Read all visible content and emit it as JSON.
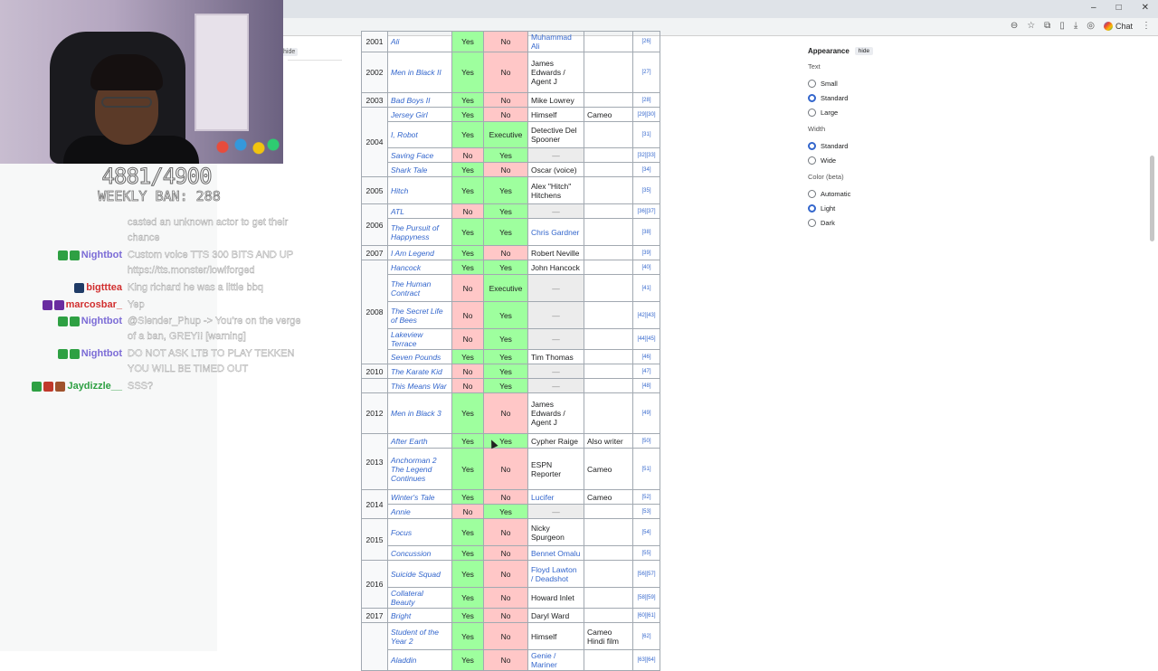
{
  "browser": {
    "win_controls": [
      "–",
      "□",
      "✕"
    ],
    "chat_label": "Chat"
  },
  "sidebar": {
    "hide_label": "hide"
  },
  "stream": {
    "counter": "4881/4900",
    "weekly": "WEEKLY BAN: 288"
  },
  "chat": [
    {
      "user": "",
      "msg": "casted an unknown actor to get their",
      "color": "#ffffff"
    },
    {
      "user": "",
      "msg": "chance",
      "color": "#ffffff"
    },
    {
      "user": "Nightbot",
      "msg": "Custom voice TTS 300 BITS AND UP",
      "color": "#7b6bd6"
    },
    {
      "user": "",
      "msg": "https://tts.monster/lowlforged",
      "color": "#ffffff"
    },
    {
      "user": "bigtttea",
      "msg": "King richard he was a little bbq",
      "color": "#d12f2f"
    },
    {
      "user": "marcosbar_",
      "msg": "Yep",
      "color": "#d12f2f"
    },
    {
      "user": "Nightbot",
      "msg": "@Slender_Phup -> You're on the verge",
      "color": "#7b6bd6"
    },
    {
      "user": "",
      "msg": "of a ban, GREY!! [warning]",
      "color": "#ffffff"
    },
    {
      "user": "Nightbot",
      "msg": "DO NOT ASK LTB TO PLAY TEKKEN",
      "color": "#7b6bd6"
    },
    {
      "user": "",
      "msg": "YOU WILL BE TIMED OUT",
      "color": "#ffffff"
    },
    {
      "user": "Jaydizzle__",
      "msg": "SSS?",
      "color": "#2ea043"
    }
  ],
  "table": {
    "rows": [
      {
        "year": "2001",
        "title": "Ali",
        "a": "Yes",
        "b": "No",
        "role": "Muhammad Ali",
        "notes": "",
        "ref": "[26]"
      },
      {
        "year": "2002",
        "title": "Men in Black II",
        "a": "Yes",
        "b": "No",
        "role": "James Edwards / Agent J",
        "notes": "",
        "ref": "[27]"
      },
      {
        "year": "2003",
        "title": "Bad Boys II",
        "a": "Yes",
        "b": "No",
        "role": "Mike Lowrey",
        "notes": "",
        "ref": "[28]"
      },
      {
        "year": "2004",
        "title": "Jersey Girl",
        "a": "Yes",
        "b": "No",
        "role": "Himself",
        "notes": "Cameo",
        "ref": "[29][30]"
      },
      {
        "year": "",
        "title": "I, Robot",
        "a": "Yes",
        "b": "Executive",
        "role": "Detective Del Spooner",
        "notes": "",
        "ref": "[31]"
      },
      {
        "year": "",
        "title": "Saving Face",
        "a": "No",
        "b": "Yes",
        "role": "—",
        "notes": "",
        "ref": "[32][33]"
      },
      {
        "year": "",
        "title": "Shark Tale",
        "a": "Yes",
        "b": "No",
        "role": "Oscar (voice)",
        "notes": "",
        "ref": "[34]"
      },
      {
        "year": "2005",
        "title": "Hitch",
        "a": "Yes",
        "b": "Yes",
        "role": "Alex \"Hitch\" Hitchens",
        "notes": "",
        "ref": "[35]"
      },
      {
        "year": "2006",
        "title": "ATL",
        "a": "No",
        "b": "Yes",
        "role": "—",
        "notes": "",
        "ref": "[36][37]"
      },
      {
        "year": "",
        "title": "The Pursuit of Happyness",
        "a": "Yes",
        "b": "Yes",
        "role": "Chris Gardner",
        "notes": "",
        "ref": "[38]"
      },
      {
        "year": "2007",
        "title": "I Am Legend",
        "a": "Yes",
        "b": "No",
        "role": "Robert Neville",
        "notes": "",
        "ref": "[39]"
      },
      {
        "year": "2008",
        "title": "Hancock",
        "a": "Yes",
        "b": "Yes",
        "role": "John Hancock",
        "notes": "",
        "ref": "[40]"
      },
      {
        "year": "",
        "title": "The Human Contract",
        "a": "No",
        "b": "Executive",
        "role": "—",
        "notes": "",
        "ref": "[41]"
      },
      {
        "year": "",
        "title": "The Secret Life of Bees",
        "a": "No",
        "b": "Yes",
        "role": "—",
        "notes": "",
        "ref": "[42][43]"
      },
      {
        "year": "",
        "title": "Lakeview Terrace",
        "a": "No",
        "b": "Yes",
        "role": "—",
        "notes": "",
        "ref": "[44][45]"
      },
      {
        "year": "",
        "title": "Seven Pounds",
        "a": "Yes",
        "b": "Yes",
        "role": "Tim Thomas",
        "notes": "",
        "ref": "[46]"
      },
      {
        "year": "2010",
        "title": "The Karate Kid",
        "a": "No",
        "b": "Yes",
        "role": "—",
        "notes": "",
        "ref": "[47]"
      },
      {
        "year": "",
        "title": "This Means War",
        "a": "No",
        "b": "Yes",
        "role": "—",
        "notes": "",
        "ref": "[48]"
      },
      {
        "year": "2012",
        "title": "Men in Black 3",
        "a": "Yes",
        "b": "No",
        "role": "James Edwards / Agent J",
        "notes": "",
        "ref": "[49]"
      },
      {
        "year": "2013",
        "title": "After Earth",
        "a": "Yes",
        "b": "Yes",
        "role": "Cypher Raige",
        "notes": "Also writer",
        "ref": "[50]"
      },
      {
        "year": "",
        "title": "Anchorman 2 The Legend Continues",
        "a": "Yes",
        "b": "No",
        "role": "ESPN Reporter",
        "notes": "Cameo",
        "ref": "[51]"
      },
      {
        "year": "2014",
        "title": "Winter's Tale",
        "a": "Yes",
        "b": "No",
        "role": "Lucifer",
        "notes": "Cameo",
        "ref": "[52]"
      },
      {
        "year": "",
        "title": "Annie",
        "a": "No",
        "b": "Yes",
        "role": "—",
        "notes": "",
        "ref": "[53]"
      },
      {
        "year": "2015",
        "title": "Focus",
        "a": "Yes",
        "b": "No",
        "role": "Nicky Spurgeon",
        "notes": "",
        "ref": "[54]"
      },
      {
        "year": "",
        "title": "Concussion",
        "a": "Yes",
        "b": "No",
        "role": "Bennet Omalu",
        "notes": "",
        "ref": "[55]"
      },
      {
        "year": "2016",
        "title": "Suicide Squad",
        "a": "Yes",
        "b": "No",
        "role": "Floyd Lawton / Deadshot",
        "notes": "",
        "ref": "[56][57]"
      },
      {
        "year": "",
        "title": "Collateral Beauty",
        "a": "Yes",
        "b": "No",
        "role": "Howard Inlet",
        "notes": "",
        "ref": "[58][59]"
      },
      {
        "year": "2017",
        "title": "Bright",
        "a": "Yes",
        "b": "No",
        "role": "Daryl Ward",
        "notes": "",
        "ref": "[60][61]"
      },
      {
        "year": "",
        "title": "Student of the Year 2",
        "a": "Yes",
        "b": "No",
        "role": "Himself",
        "notes": "Cameo Hindi film",
        "ref": "[62]"
      },
      {
        "year": "",
        "title": "Aladdin",
        "a": "Yes",
        "b": "No",
        "role": "Genie / Mariner",
        "notes": "",
        "ref": "[63][64]"
      }
    ]
  },
  "appearance": {
    "title": "Appearance",
    "hide": "hide",
    "text_label": "Text",
    "text_opts": [
      "Small",
      "Standard",
      "Large"
    ],
    "text_sel": 1,
    "width_label": "Width",
    "width_opts": [
      "Standard",
      "Wide"
    ],
    "width_sel": 0,
    "color_label": "Color (beta)",
    "color_opts": [
      "Automatic",
      "Light",
      "Dark"
    ],
    "color_sel": 1
  },
  "colors": {
    "yes": "#9eff9e",
    "no": "#ffc7c7",
    "link": "#3366cc"
  }
}
